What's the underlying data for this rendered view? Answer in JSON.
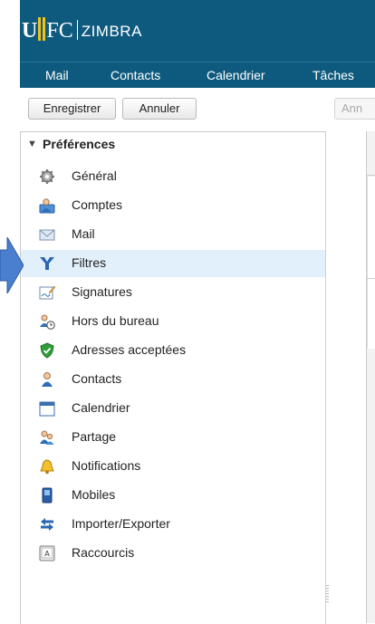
{
  "header": {
    "logo_u": "U",
    "logo_fc": "FC",
    "logo_product": "ZIMBRA"
  },
  "nav": {
    "items": [
      "Mail",
      "Contacts",
      "Calendrier",
      "Tâches"
    ]
  },
  "toolbar": {
    "save_label": "Enregistrer",
    "cancel_label": "Annuler",
    "partial_label": "Ann"
  },
  "tree": {
    "root_label": "Préférences",
    "selected": "Filtres",
    "items": [
      {
        "label": "Général",
        "icon": "gear-icon"
      },
      {
        "label": "Comptes",
        "icon": "accounts-icon"
      },
      {
        "label": "Mail",
        "icon": "envelope-icon"
      },
      {
        "label": "Filtres",
        "icon": "filter-icon"
      },
      {
        "label": "Signatures",
        "icon": "signature-icon"
      },
      {
        "label": "Hors du bureau",
        "icon": "out-of-office-icon"
      },
      {
        "label": "Adresses acceptées",
        "icon": "shield-check-icon"
      },
      {
        "label": "Contacts",
        "icon": "contact-icon"
      },
      {
        "label": "Calendrier",
        "icon": "calendar-icon"
      },
      {
        "label": "Partage",
        "icon": "sharing-icon"
      },
      {
        "label": "Notifications",
        "icon": "bell-icon"
      },
      {
        "label": "Mobiles",
        "icon": "mobile-icon"
      },
      {
        "label": "Importer/Exporter",
        "icon": "import-export-icon"
      },
      {
        "label": "Raccourcis",
        "icon": "keyboard-shortcut-icon"
      }
    ]
  },
  "colors": {
    "header_bg": "#0e5a7e",
    "selection_bg": "#e2f0fb",
    "pointer": "#4a7fd0"
  }
}
